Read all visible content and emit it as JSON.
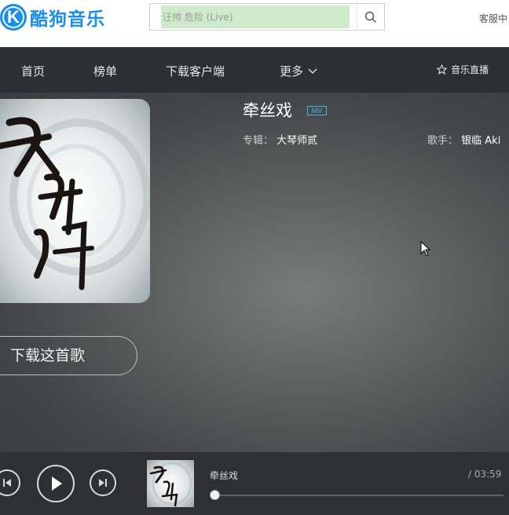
{
  "header": {
    "logo_text": "酷狗音乐",
    "search": {
      "placeholder": "汪帅 危险 (Live)"
    },
    "service_link": "客服中"
  },
  "nav": {
    "items": [
      "首页",
      "榜单",
      "下载客户端",
      "更多"
    ],
    "live": "音乐直播"
  },
  "song": {
    "title": "牵丝戏",
    "mv_badge": "MV",
    "album_label": "专辑：",
    "album": "大琴师贰",
    "singer_label": "歌手：",
    "singer": "银临 Aki",
    "cover_text": "大琴師",
    "download_label": "下载这首歌"
  },
  "player": {
    "title": "牵丝戏",
    "time": "/ 03:59",
    "progress": 0.0
  },
  "colors": {
    "brand": "#1a8fe8",
    "nav_bg": "#2c2f33",
    "mv_badge": "#37b6e0",
    "player_bg": "#2e3033"
  }
}
